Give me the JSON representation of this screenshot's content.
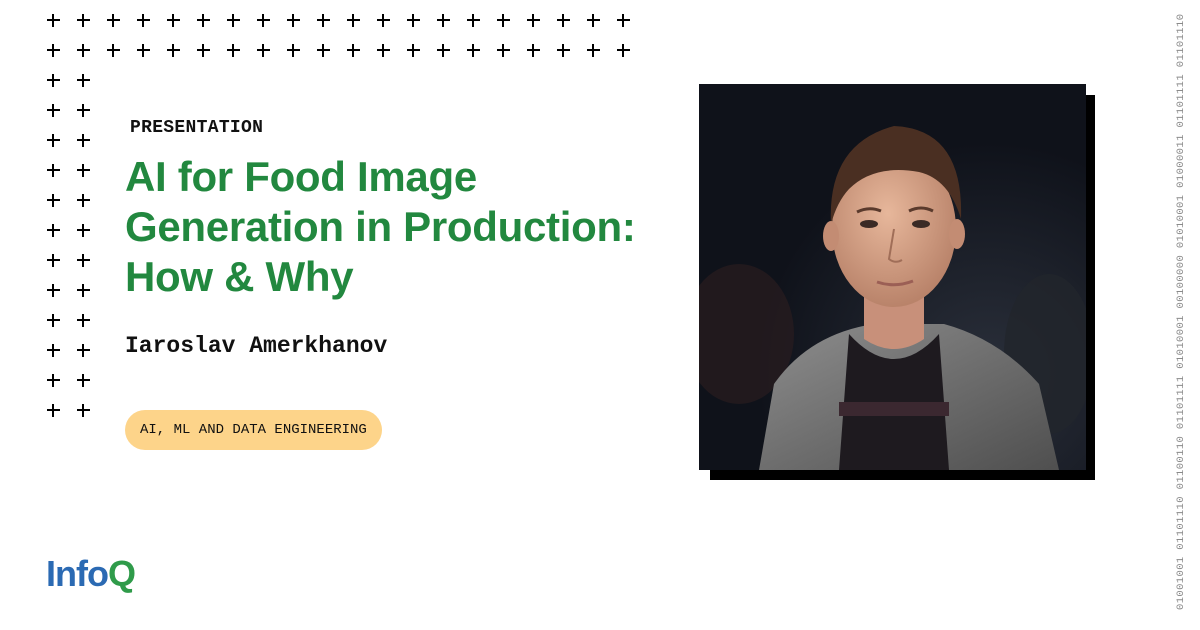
{
  "eyebrow": "PRESENTATION",
  "title": {
    "line1": "AI for Food Image",
    "line2": "Generation in Production:",
    "line3": "How & Why"
  },
  "speaker": "Iaroslav Amerkhanov",
  "topic": "AI, ML AND DATA ENGINEERING",
  "binary_text": "01001001 01101110 01100110 01101111 01010001 00100000 01010001 01000011 01101111 01101110",
  "logo": {
    "part1": "Info",
    "part2": "Q"
  },
  "colors": {
    "title": "#22883f",
    "badge": "#fdd48a",
    "logo_info": "#2b6ab3",
    "logo_q": "#2f9b4a"
  },
  "icons": [
    "plus-icon"
  ]
}
